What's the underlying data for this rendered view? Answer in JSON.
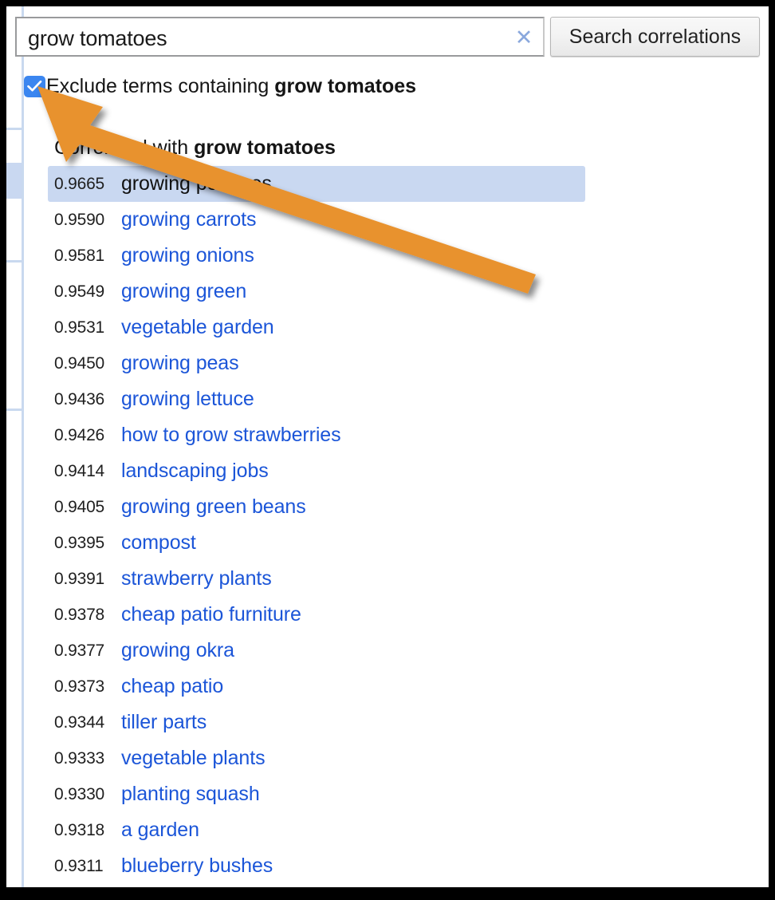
{
  "search": {
    "value": "grow tomatoes",
    "placeholder": "Search correlations",
    "clear_icon": "close-x-icon",
    "button_label": "Search correlations"
  },
  "exclude": {
    "checked": true,
    "label_prefix": "Exclude terms containing ",
    "label_term": "grow tomatoes",
    "checkbox_icon": "checkmark-icon"
  },
  "results": {
    "title_prefix": "Correlated with ",
    "title_term": "grow tomatoes",
    "rows": [
      {
        "score": "0.9665",
        "term": "growing potatoes"
      },
      {
        "score": "0.9590",
        "term": "growing carrots"
      },
      {
        "score": "0.9581",
        "term": "growing onions"
      },
      {
        "score": "0.9549",
        "term": "growing green"
      },
      {
        "score": "0.9531",
        "term": "vegetable garden"
      },
      {
        "score": "0.9450",
        "term": "growing peas"
      },
      {
        "score": "0.9436",
        "term": "growing lettuce"
      },
      {
        "score": "0.9426",
        "term": "how to grow strawberries"
      },
      {
        "score": "0.9414",
        "term": "landscaping jobs"
      },
      {
        "score": "0.9405",
        "term": "growing green beans"
      },
      {
        "score": "0.9395",
        "term": "compost"
      },
      {
        "score": "0.9391",
        "term": "strawberry plants"
      },
      {
        "score": "0.9378",
        "term": "cheap patio furniture"
      },
      {
        "score": "0.9377",
        "term": "growing okra"
      },
      {
        "score": "0.9373",
        "term": "cheap patio"
      },
      {
        "score": "0.9344",
        "term": "tiller parts"
      },
      {
        "score": "0.9333",
        "term": "vegetable plants"
      },
      {
        "score": "0.9330",
        "term": "planting squash"
      },
      {
        "score": "0.9318",
        "term": "a garden"
      },
      {
        "score": "0.9311",
        "term": "blueberry bushes"
      }
    ],
    "highlighted_index": 0
  },
  "annotation": {
    "arrow_icon": "orange-arrow-pointing-to-checkbox",
    "color": "#e8922f"
  },
  "colors": {
    "link": "#1b55d8",
    "highlight_row": "#c9d8f1",
    "checkbox": "#3b86f0",
    "arrow": "#e8922f",
    "gutter_line": "#c9d9ef",
    "frame": "#000000"
  }
}
